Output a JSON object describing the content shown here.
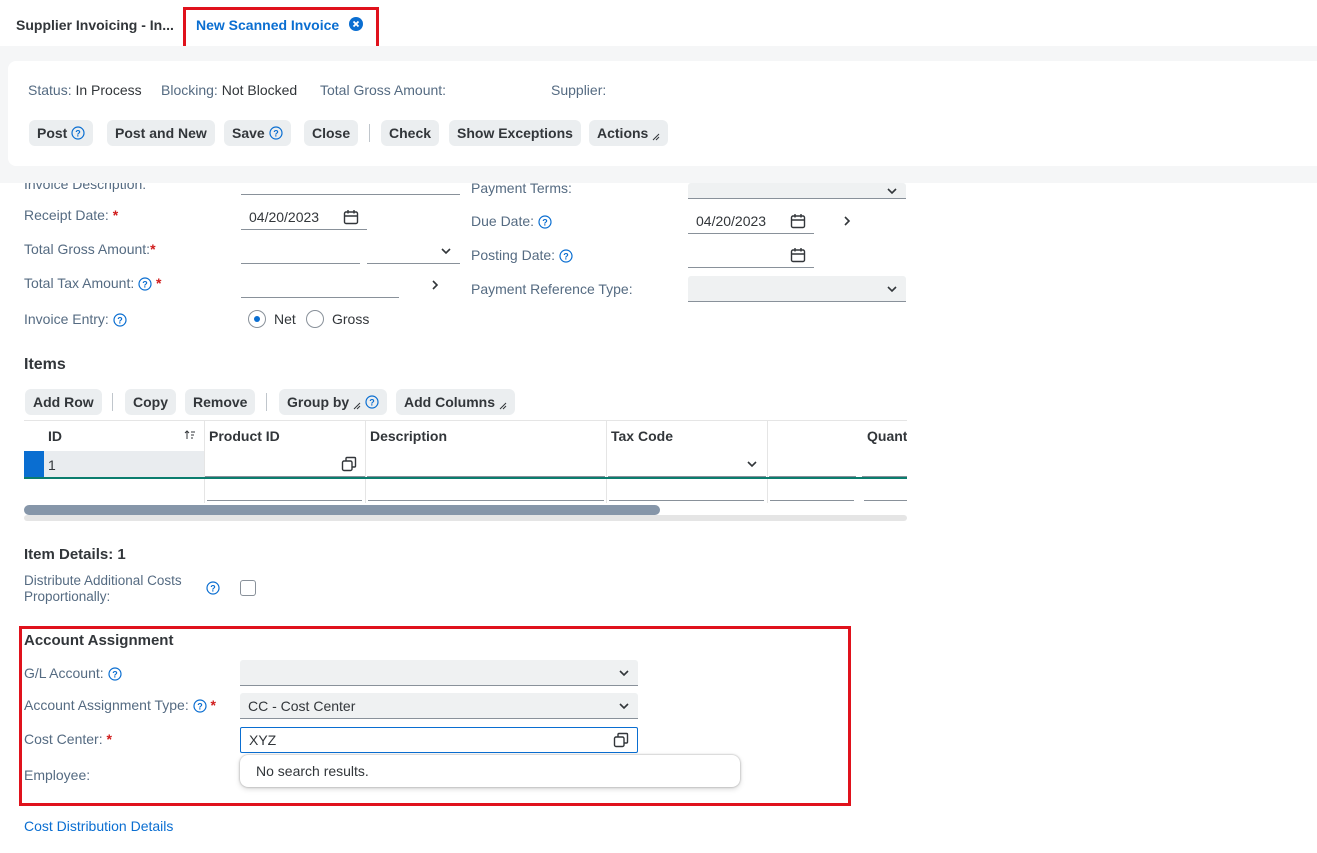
{
  "tabs": {
    "inactive_label": "Supplier Invoicing - In...",
    "active_label": "New Scanned Invoice"
  },
  "header": {
    "status_label": "Status:",
    "status_value": "In Process",
    "blocking_label": "Blocking:",
    "blocking_value": "Not Blocked",
    "gross_label": "Total Gross Amount:",
    "supplier_label": "Supplier:"
  },
  "toolbar": {
    "post": "Post",
    "post_and_new": "Post and New",
    "save": "Save",
    "close": "Close",
    "check": "Check",
    "show_exceptions": "Show Exceptions",
    "actions": "Actions"
  },
  "form": {
    "invoice_description_label": "Invoice Description:",
    "receipt_date_label": "Receipt Date:",
    "receipt_date_value": "04/20/2023",
    "total_gross_label": "Total Gross Amount:",
    "total_tax_label": "Total Tax Amount:",
    "invoice_entry_label": "Invoice Entry:",
    "net_label": "Net",
    "gross_label": "Gross",
    "payment_terms_label": "Payment Terms:",
    "due_date_label": "Due Date:",
    "due_date_value": "04/20/2023",
    "posting_date_label": "Posting Date:",
    "payment_ref_type_label": "Payment Reference Type:"
  },
  "items": {
    "title": "Items",
    "buttons": {
      "add_row": "Add Row",
      "copy": "Copy",
      "remove": "Remove",
      "group_by": "Group by",
      "add_columns": "Add Columns"
    },
    "columns": {
      "id": "ID",
      "product_id": "Product ID",
      "description": "Description",
      "tax_code": "Tax Code",
      "quantity": "Quant"
    },
    "rows": [
      {
        "id": "1"
      }
    ]
  },
  "item_details": {
    "title": "Item Details: 1",
    "distribute_label_line1": "Distribute Additional Costs",
    "distribute_label_line2": "Proportionally:"
  },
  "account_assignment": {
    "title": "Account Assignment",
    "gl_account_label": "G/L Account:",
    "type_label": "Account Assignment Type:",
    "type_value": "CC - Cost Center",
    "cost_center_label": "Cost Center:",
    "cost_center_value": "XYZ",
    "employee_label": "Employee:",
    "suggestion_text": "No search results."
  },
  "links": {
    "cost_distribution": "Cost Distribution Details"
  },
  "colors": {
    "accent": "#0a6ed1",
    "highlight": "#e0121c",
    "required": "#d01c1c"
  }
}
